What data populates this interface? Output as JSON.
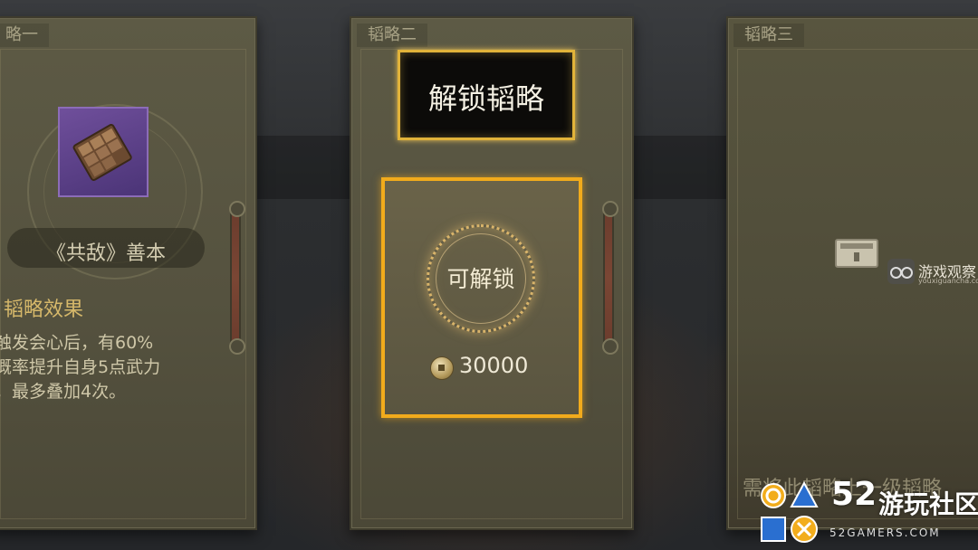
{
  "panels": [
    {
      "tab": "略一",
      "item_name": "《共敌》善本",
      "effect_title": "韬略效果",
      "effect_lines": [
        "触发会心后，有60%",
        "概率提升自身5点武力",
        "，最多叠加4次。"
      ]
    },
    {
      "tab": "韬略二",
      "unlock_button": "解锁韬略",
      "ring_label": "可解锁",
      "cost": "30000"
    },
    {
      "tab": "韬略三",
      "hint": "需将此韬略上一级韬略"
    }
  ],
  "watermark": {
    "name": "游戏观察",
    "site": "youxiguancha.com"
  },
  "logo": {
    "number": "52",
    "name": "游玩社区",
    "site": "52GAMERS.COM"
  },
  "colors": {
    "gold_border": "#f1ab1c",
    "button_border": "#e1b33a",
    "panel": "#5d5a45",
    "item_purple": "#6f4f9b"
  },
  "icons": [
    "book-item-icon",
    "coin-icon",
    "lock-icon",
    "watermark-eye-icon",
    "playstation-shapes-icon"
  ]
}
